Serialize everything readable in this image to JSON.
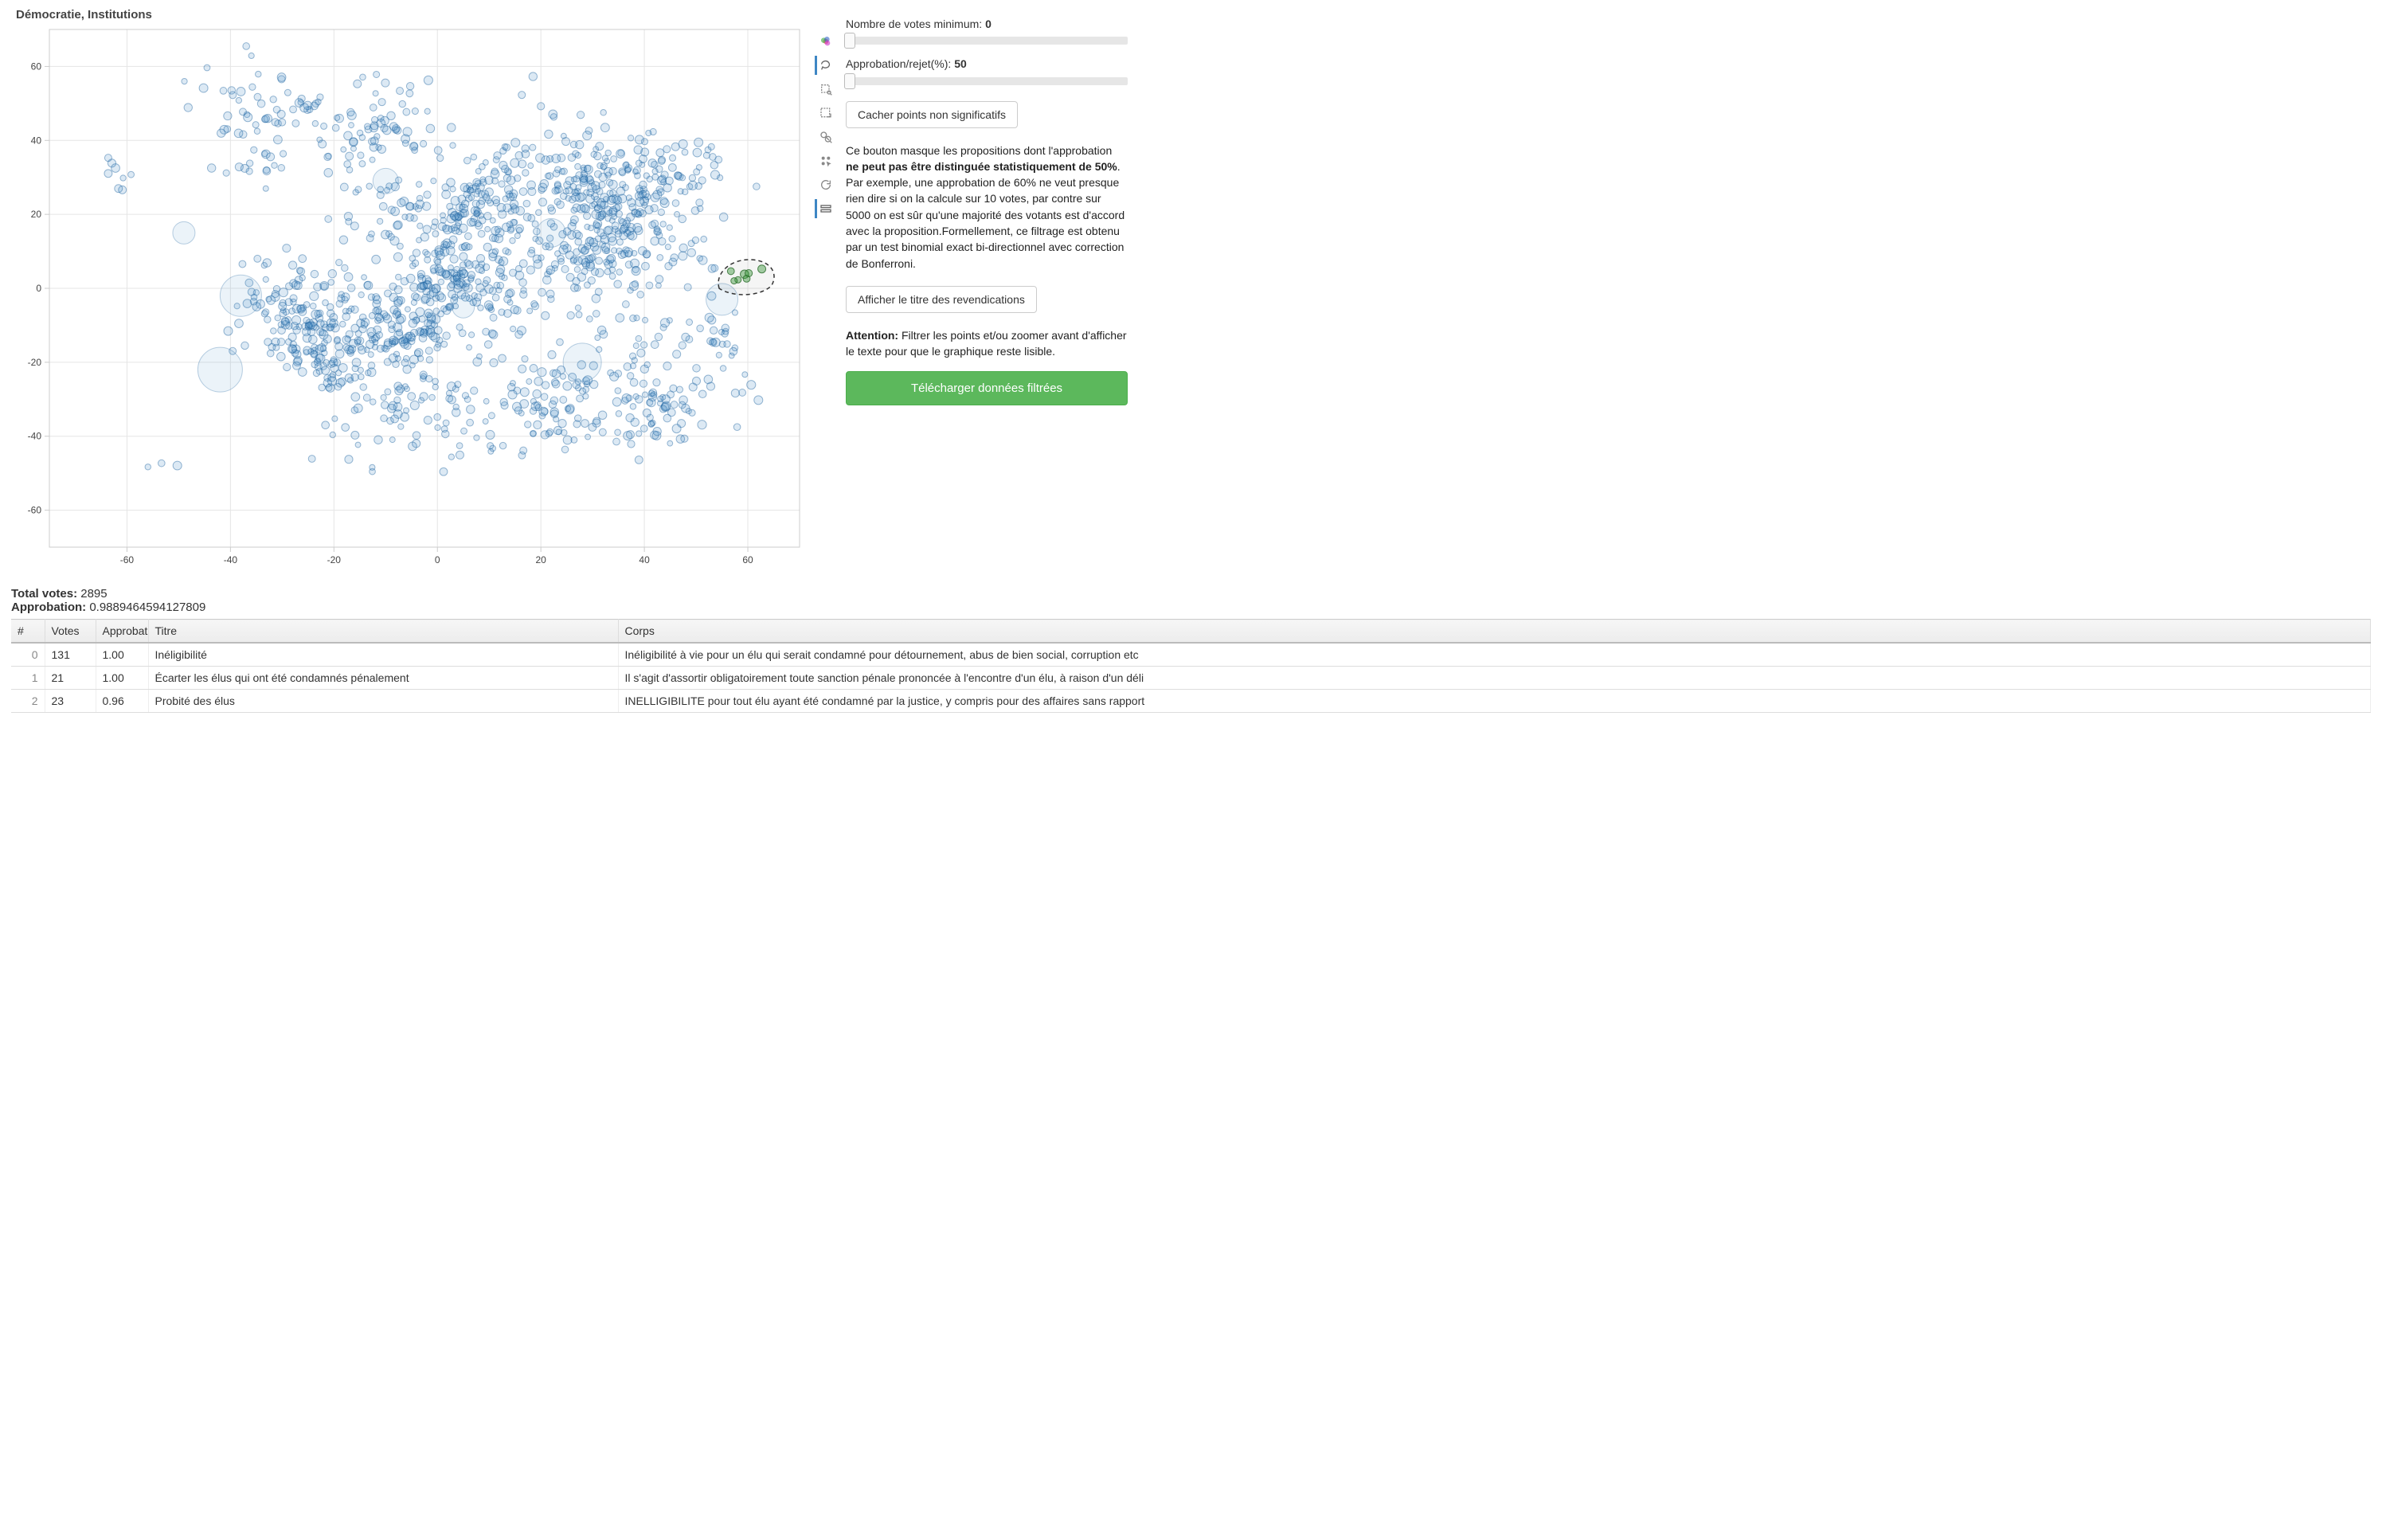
{
  "chart_data": {
    "type": "scatter",
    "title": "Démocratie, Institutions",
    "xlabel": "",
    "ylabel": "",
    "xlim": [
      -75,
      70
    ],
    "ylim": [
      -70,
      70
    ],
    "x_ticks": [
      -60,
      -40,
      -20,
      0,
      20,
      40,
      60
    ],
    "y_ticks": [
      -60,
      -40,
      -20,
      0,
      20,
      40,
      60
    ],
    "note": "Approx. 1400 blue points spread across the plane; a small green lasso-selected cluster near (60, 3). Individual point coordinates are approximate reproductions of a t-SNE-style embedding.",
    "selected_cluster": {
      "cx": 60,
      "cy": 3
    }
  },
  "toolbar": {
    "tools": [
      {
        "name": "bokeh-logo-icon",
        "active": false
      },
      {
        "name": "lasso-icon",
        "active": true
      },
      {
        "name": "box-zoom-icon",
        "active": false
      },
      {
        "name": "box-select-icon",
        "active": false
      },
      {
        "name": "zoom-in-icon",
        "active": false
      },
      {
        "name": "tap-icon",
        "active": false
      },
      {
        "name": "reset-icon",
        "active": false
      },
      {
        "name": "hover-icon",
        "active": true
      }
    ]
  },
  "sidebar": {
    "slider1_label": "Nombre de votes minimum: ",
    "slider1_value": "0",
    "slider2_label": "Approbation/rejet(%): ",
    "slider2_value": "50",
    "btn_hide": "Cacher points non significatifs",
    "help1_pre": "Ce bouton masque les propositions dont l'approbation ",
    "help1_bold": "ne peut pas être distinguée statistiquement de 50%",
    "help1_post": ". Par exemple, une approbation de 60% ne veut presque rien dire si on la calcule sur 10 votes, par contre sur 5000 on est sûr qu'une majorité des votants est d'accord avec la proposition.Formellement, ce filtrage est obtenu par un test binomial exact bi-directionnel avec correction de Bonferroni.",
    "btn_show_titles": "Afficher le titre des revendications",
    "warn_label": "Attention:",
    "warn_text": " Filtrer les points et/ou zoomer avant d'afficher le texte pour que le graphique reste lisible.",
    "btn_download": "Télécharger données filtrées"
  },
  "summary": {
    "total_label": "Total votes: ",
    "total_value": "2895",
    "approval_label": "Approbation: ",
    "approval_value": "0.9889464594127809"
  },
  "table": {
    "headers": [
      "#",
      "Votes",
      "Approbati",
      "Titre",
      "Corps"
    ],
    "rows": [
      {
        "idx": "0",
        "votes": "131",
        "appro": "1.00",
        "titre": "Inéligibilité",
        "corps": "Inéligibilité à vie pour un élu qui serait condamné pour détournement, abus de bien social, corruption etc"
      },
      {
        "idx": "1",
        "votes": "21",
        "appro": "1.00",
        "titre": "Écarter les élus qui ont été condamnés pénalement",
        "corps": "Il s'agit d'assortir obligatoirement toute sanction pénale prononcée à l'encontre d'un élu, à raison d'un déli"
      },
      {
        "idx": "2",
        "votes": "23",
        "appro": "0.96",
        "titre": "Probité des élus",
        "corps": "INELLIGIBILITE pour tout élu ayant été condamné par la justice, y compris pour des affaires sans rapport"
      }
    ]
  }
}
